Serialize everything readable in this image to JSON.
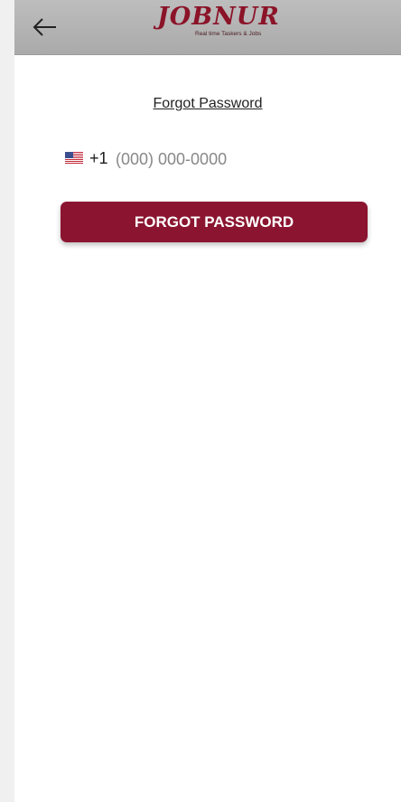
{
  "header": {
    "back_icon": "arrow-left-icon",
    "logo_text": "JOBNUR",
    "logo_tagline": "Real time Taskers & Jobs"
  },
  "main": {
    "title": "Forgot Password",
    "phone": {
      "flag_icon": "us-flag-icon",
      "country_code": "+1",
      "placeholder": "(000) 000-0000",
      "value": ""
    },
    "submit_label": "FORGOT PASSWORD"
  },
  "colors": {
    "brand": "#8b1530",
    "header_bg": "#b3b3b3"
  }
}
